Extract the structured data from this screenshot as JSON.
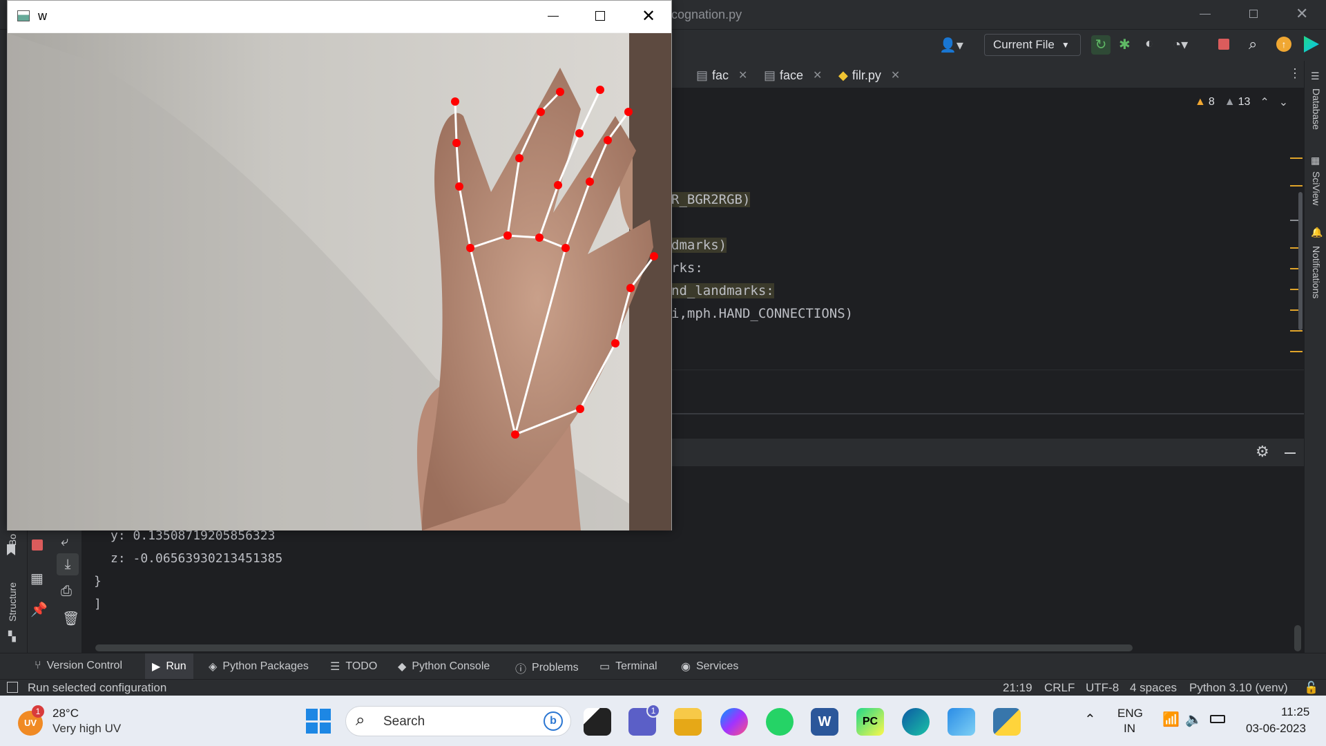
{
  "ide": {
    "title_partial": "cognation.py",
    "run_config": "Current File",
    "tabs": [
      {
        "label": "fac"
      },
      {
        "label": "face"
      },
      {
        "label": "filr.py"
      }
    ],
    "inspections": {
      "warnings": "8",
      "weak_warnings": "13"
    },
    "code_lines": [
      "R_BGR2RGB)",
      "dmarks)",
      "rks:",
      "nd_landmarks:",
      "i,mph.HAND_CONNECTIONS)"
    ],
    "right_tools": [
      "Database",
      "SciView",
      "Notifications"
    ],
    "left_tools": [
      "Bo",
      "Structure"
    ],
    "console_lines": [
      "y: 0.13508719205856323",
      "z: -0.06563930213451385",
      "}",
      "]"
    ],
    "bottom_tabs": [
      "Version Control",
      "Run",
      "Python Packages",
      "TODO",
      "Python Console",
      "Problems",
      "Terminal",
      "Services"
    ],
    "status": {
      "message": "Run selected configuration",
      "position": "21:19",
      "line_sep": "CRLF",
      "encoding": "UTF-8",
      "indent": "4 spaces",
      "interpreter": "Python 3.10 (venv)"
    }
  },
  "camera_window": {
    "title": "w",
    "hand_keypoints_count": "21"
  },
  "taskbar": {
    "weather": {
      "temp": "28°C",
      "desc": "Very high UV",
      "badge": "1",
      "avatar": "UV"
    },
    "search_placeholder": "Search",
    "teams_badge": "1",
    "lang": [
      "ENG",
      "IN"
    ],
    "time": "11:25",
    "date": "03-06-2023"
  },
  "colors": {
    "accent": "#3574f0",
    "landmark": "#ff0000",
    "connection": "#ffffff"
  }
}
